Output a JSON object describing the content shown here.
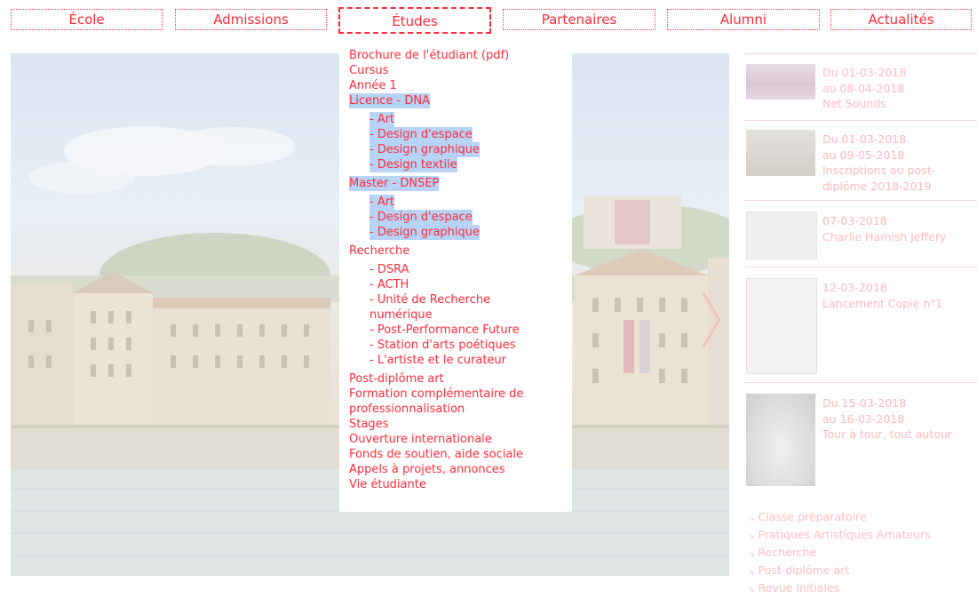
{
  "nav": {
    "items": [
      {
        "label": "École"
      },
      {
        "label": "Admissions"
      },
      {
        "label": "Études"
      },
      {
        "label": "Partenaires"
      },
      {
        "label": "Alumni"
      },
      {
        "label": "Actualités"
      }
    ],
    "active_index": 2
  },
  "dropdown": {
    "brochure": "Brochure de l'étudiant (pdf)",
    "cursus": "Cursus",
    "annee1": "Année 1",
    "licence": "Licence - DNA",
    "licence_items": [
      "- Art",
      "- Design d'espace",
      "- Design graphique",
      "- Design textile"
    ],
    "master": "Master - DNSEP",
    "master_items": [
      "- Art",
      "- Design d'espace",
      "- Design graphique"
    ],
    "recherche": "Recherche",
    "recherche_items": [
      "- DSRA",
      "- ACTH",
      "- Unité de Recherche numérique",
      "- Post-Performance Future",
      "- Station d'arts poétiques",
      "- L'artiste et le curateur"
    ],
    "bottom_items": [
      "Post-diplôme art",
      "Formation complémentaire de professionnalisation",
      "Stages",
      "Ouverture internationale",
      "Fonds de soutien, aide sociale",
      "Appels à projets, annonces",
      "Vie étudiante"
    ]
  },
  "news": [
    {
      "lines": [
        "Du 01-03-2018",
        "au 08-04-2018",
        "Net Sounds"
      ]
    },
    {
      "lines": [
        "Du 01-03-2018",
        "au 09-05-2018",
        "Inscriptions au post-diplôme 2018-2019"
      ]
    },
    {
      "lines": [
        "07-03-2018",
        "Charlie Hamish Jeffery"
      ]
    },
    {
      "lines": [
        "12-03-2018",
        "Lancement Copie n°1"
      ]
    },
    {
      "lines": [
        "Du 15-03-2018",
        "au 16-03-2018",
        "Tour à tour, tout autour"
      ]
    }
  ],
  "footer_links": [
    "Classe préparatoire",
    "Pratiques Artistiques Amateurs",
    "Recherche",
    "Post-diplôme art",
    "Revue Initiales"
  ],
  "colors": {
    "accent": "#ff2b3a",
    "highlight": "#b7d3f5",
    "faded": "#ffb8bf"
  }
}
